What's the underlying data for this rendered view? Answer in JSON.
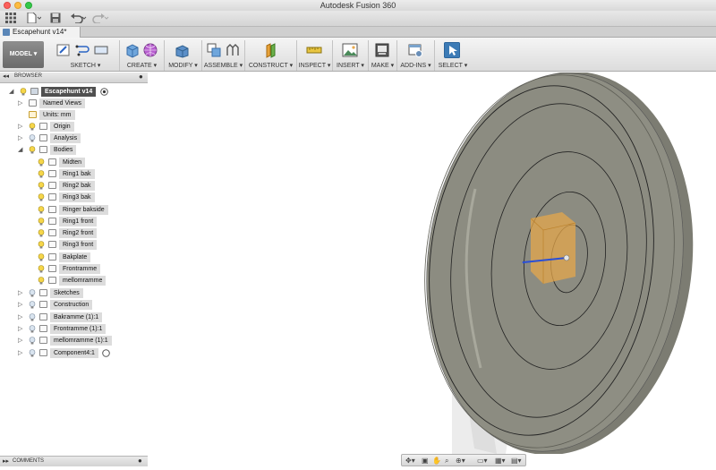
{
  "window": {
    "title": "Autodesk Fusion 360"
  },
  "document": {
    "tab_label": "Escapehunt v14*"
  },
  "toolbar": {
    "workspace": "MODEL",
    "groups": [
      "SKETCH",
      "CREATE",
      "MODIFY",
      "ASSEMBLE",
      "CONSTRUCT",
      "INSPECT",
      "INSERT",
      "MAKE",
      "ADD-INS",
      "SELECT"
    ]
  },
  "browser": {
    "title": "BROWSER",
    "root": "Escapehunt v14",
    "items": [
      {
        "label": "Named Views"
      },
      {
        "label": "Units: mm"
      },
      {
        "label": "Origin"
      },
      {
        "label": "Analysis"
      },
      {
        "label": "Bodies"
      },
      {
        "label": "Midten"
      },
      {
        "label": "Ring1 bak"
      },
      {
        "label": "Ring2 bak"
      },
      {
        "label": "Ring3 bak"
      },
      {
        "label": "Ringer bakside"
      },
      {
        "label": "Ring1 front"
      },
      {
        "label": "Ring2 front"
      },
      {
        "label": "Ring3 front"
      },
      {
        "label": "Bakplate"
      },
      {
        "label": "Frontramme"
      },
      {
        "label": "mellomramme"
      },
      {
        "label": "Sketches"
      },
      {
        "label": "Construction"
      },
      {
        "label": "Bakramme (1):1"
      },
      {
        "label": "Frontramme (1):1"
      },
      {
        "label": "mellomramme (1):1"
      },
      {
        "label": "Component4:1"
      }
    ]
  },
  "comments": {
    "title": "COMMENTS"
  },
  "colors": {
    "body_grey": "#8a8a7e",
    "selection_orange": "#e8a74a",
    "axis_blue": "#2a4fd6"
  }
}
